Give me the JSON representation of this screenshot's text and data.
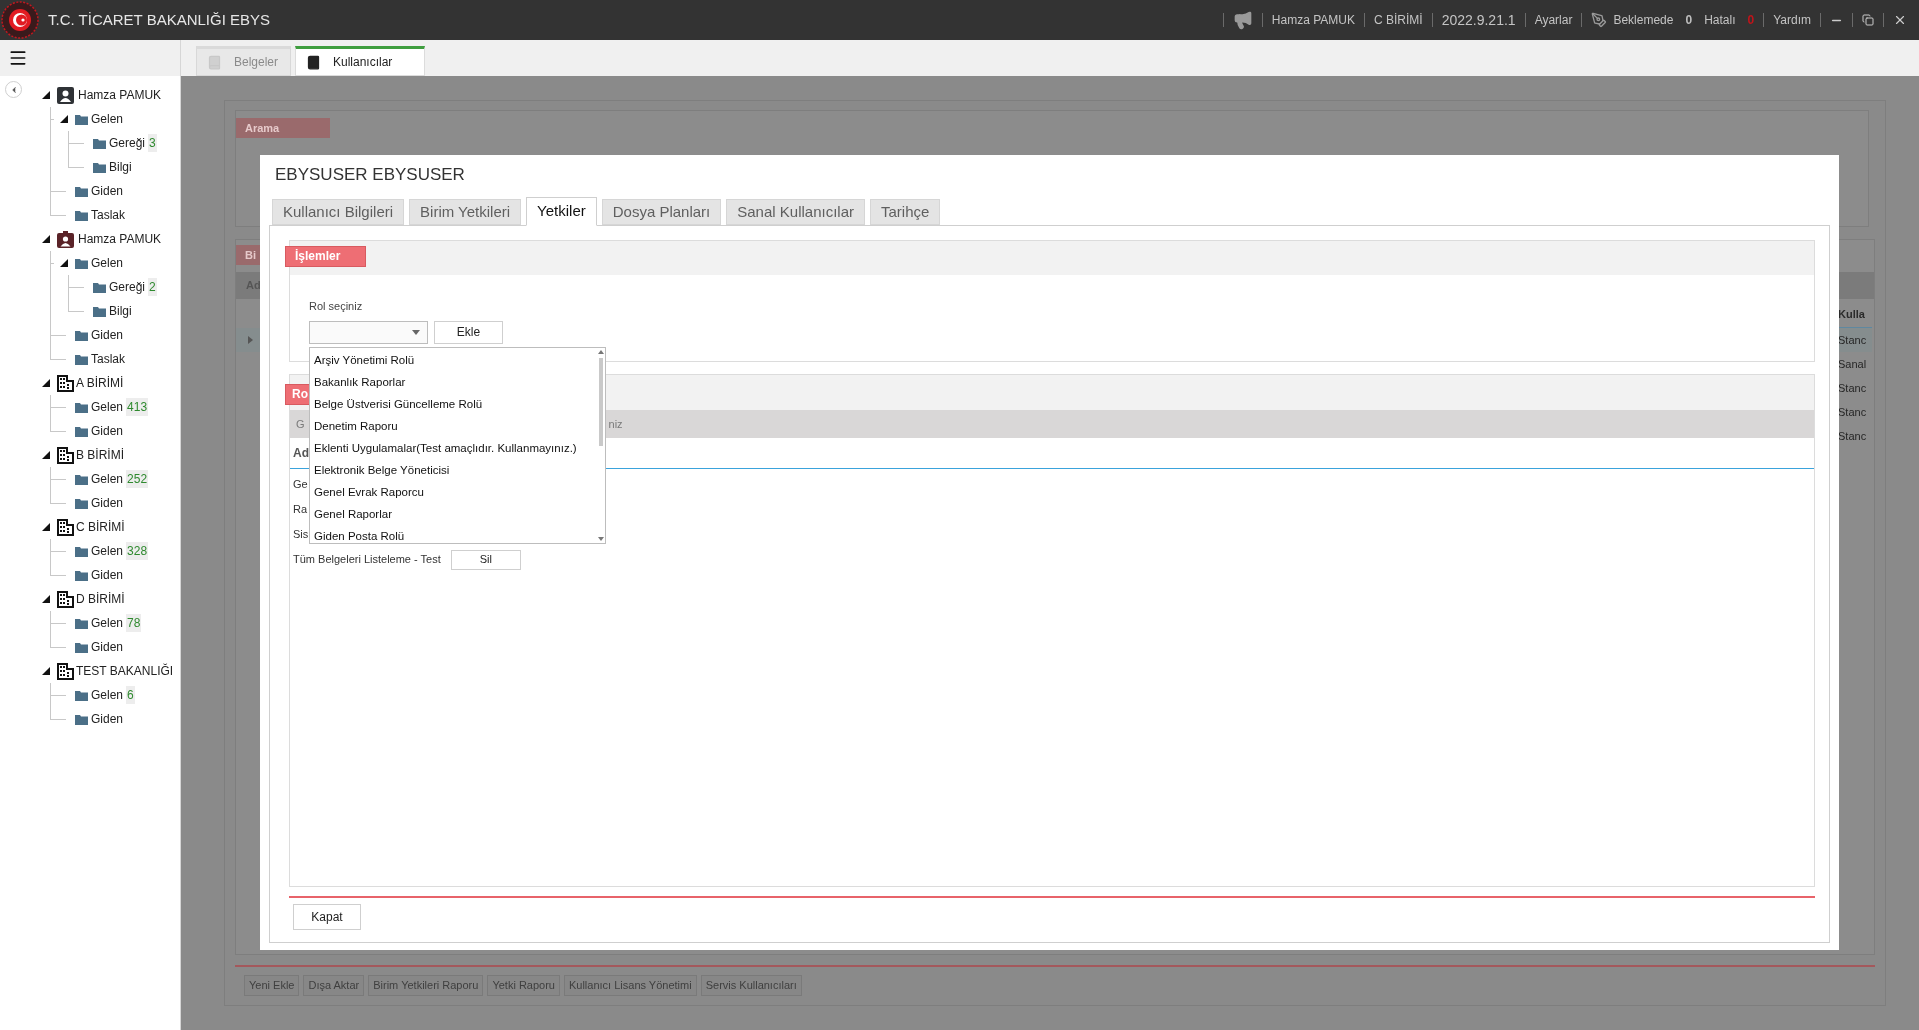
{
  "app": {
    "title": "T.C. TİCARET BAKANLIĞI EBYS"
  },
  "header": {
    "user": "Hamza PAMUK",
    "unit": "C BİRİMİ",
    "version": "2022.9.21.1",
    "settings": "Ayarlar",
    "pending_label": "Beklemede",
    "pending_count": "0",
    "error_label": "Hatalı",
    "error_count": "0",
    "help": "Yardım"
  },
  "doc_tabs": [
    {
      "label": "Belgeler",
      "selected": false
    },
    {
      "label": "Kullanıcılar",
      "selected": true
    }
  ],
  "tree": [
    {
      "label": "Hamza PAMUK",
      "kind": "user",
      "expanded": true,
      "children": [
        {
          "label": "Gelen",
          "kind": "folder",
          "expanded": true,
          "children": [
            {
              "label": "Gereği",
              "kind": "folder",
              "count": "3"
            },
            {
              "label": "Bilgi",
              "kind": "folder"
            }
          ]
        },
        {
          "label": "Giden",
          "kind": "folder"
        },
        {
          "label": "Taslak",
          "kind": "folder"
        }
      ]
    },
    {
      "label": "Hamza PAMUK",
      "kind": "badge",
      "expanded": true,
      "children": [
        {
          "label": "Gelen",
          "kind": "folder",
          "expanded": true,
          "children": [
            {
              "label": "Gereği",
              "kind": "folder",
              "count": "2"
            },
            {
              "label": "Bilgi",
              "kind": "folder"
            }
          ]
        },
        {
          "label": "Giden",
          "kind": "folder"
        },
        {
          "label": "Taslak",
          "kind": "folder"
        }
      ]
    },
    {
      "label": "A BİRİMİ",
      "kind": "unit",
      "expanded": true,
      "children": [
        {
          "label": "Gelen",
          "kind": "folder",
          "count": "413"
        },
        {
          "label": "Giden",
          "kind": "folder"
        }
      ]
    },
    {
      "label": "B BİRİMİ",
      "kind": "unit",
      "expanded": true,
      "children": [
        {
          "label": "Gelen",
          "kind": "folder",
          "count": "252"
        },
        {
          "label": "Giden",
          "kind": "folder"
        }
      ]
    },
    {
      "label": "C BİRİMİ",
      "kind": "unit",
      "expanded": true,
      "children": [
        {
          "label": "Gelen",
          "kind": "folder",
          "count": "328"
        },
        {
          "label": "Giden",
          "kind": "folder"
        }
      ]
    },
    {
      "label": "D BİRİMİ",
      "kind": "unit",
      "expanded": true,
      "children": [
        {
          "label": "Gelen",
          "kind": "folder",
          "count": "78"
        },
        {
          "label": "Giden",
          "kind": "folder"
        }
      ]
    },
    {
      "label": "TEST BAKANLIĞI",
      "kind": "unit",
      "expanded": true,
      "children": [
        {
          "label": "Gelen",
          "kind": "folder",
          "count": "6"
        },
        {
          "label": "Giden",
          "kind": "folder"
        }
      ]
    }
  ],
  "background": {
    "search_tag": "Arama",
    "list_tag": "Bi",
    "column_fragment": "Ad",
    "right_column": {
      "header": "Kulla",
      "rows": [
        {
          "text": "Stanc",
          "selected": true
        },
        {
          "text": "Sanal",
          "selected": false
        },
        {
          "text": "Stanc",
          "selected": false
        },
        {
          "text": "Stanc",
          "selected": false
        },
        {
          "text": "Stanc",
          "selected": false
        }
      ]
    },
    "buttons": [
      "Yeni Ekle",
      "Dışa Aktar",
      "Birim Yetkileri Raporu",
      "Yetki Raporu",
      "Kullanıcı Lisans Yönetimi",
      "Servis Kullanıcıları"
    ]
  },
  "dialog": {
    "title": "EBYSUSER EBYSUSER",
    "tabs": [
      {
        "label": "Kullanıcı Bilgileri",
        "selected": false
      },
      {
        "label": "Birim Yetkileri",
        "selected": false
      },
      {
        "label": "Yetkiler",
        "selected": true
      },
      {
        "label": "Dosya Planları",
        "selected": false
      },
      {
        "label": "Sanal Kullanıcılar",
        "selected": false
      },
      {
        "label": "Tarihçe",
        "selected": false
      }
    ],
    "operations": {
      "tag": "İşlemler",
      "role_label": "Rol seçiniz",
      "add_button": "Ekle",
      "dropdown": {
        "expanded": true,
        "options": [
          "Arşiv Yönetimi Rolü",
          "Bakanlık Raporlar",
          "Belge Üstverisi Güncelleme Rolü",
          "Denetim Raporu",
          "Eklenti Uygulamalar(Test amaçlıdır. Kullanmayınız.)",
          "Elektronik Belge Yöneticisi",
          "Genel Evrak Raporcu",
          "Genel Raporlar",
          "Giden Posta Rolü"
        ]
      }
    },
    "roles": {
      "tag": "Ro",
      "group_hint_start": "G",
      "group_hint_end": "niz",
      "column": "Ad",
      "rows": [
        {
          "name": "Ge"
        },
        {
          "name": "Ra"
        },
        {
          "name": "Sis"
        },
        {
          "name": "Tüm Belgeleri Listeleme - Test",
          "action": "Sil"
        }
      ]
    },
    "close_button": "Kapat"
  }
}
